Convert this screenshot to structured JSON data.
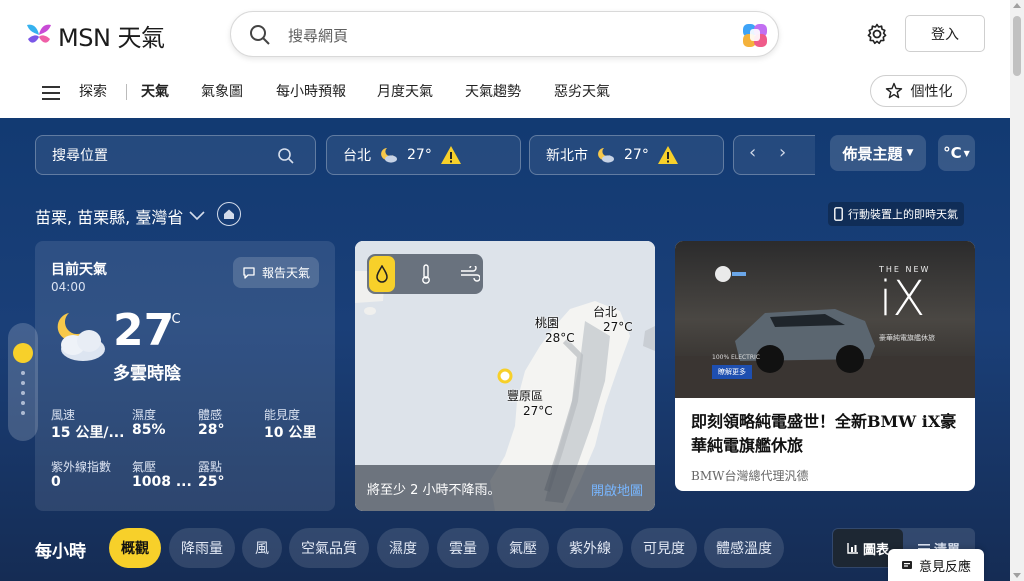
{
  "header": {
    "logo_text": "MSN 天氣",
    "search_placeholder": "搜尋網頁",
    "login_label": "登入"
  },
  "nav": {
    "explore": "探索",
    "items": [
      "天氣",
      "氣象圖",
      "每小時預報",
      "月度天氣",
      "天氣趨勢",
      "惡劣天氣"
    ],
    "active": "天氣",
    "personalize": "個性化"
  },
  "toolbar": {
    "location_search": "搜尋位置",
    "cities": [
      {
        "name": "台北",
        "temp": "27°"
      },
      {
        "name": "新北市",
        "temp": "27°"
      }
    ],
    "theme": "佈景主題",
    "unit": "°C"
  },
  "location": {
    "name": "苗栗, 苗栗縣, 臺灣省",
    "mobile_link": "行動裝置上的即時天氣"
  },
  "current": {
    "title": "目前天氣",
    "time": "04:00",
    "report_label": "報告天氣",
    "temp": "27",
    "unit": "°C",
    "condition": "多雲時陰",
    "stats": [
      {
        "label": "風速",
        "value": "15 公里/..."
      },
      {
        "label": "濕度",
        "value": "85%"
      },
      {
        "label": "體感",
        "value": "28°"
      },
      {
        "label": "能見度",
        "value": "10 公里"
      },
      {
        "label": "紫外線指數",
        "value": "0"
      },
      {
        "label": "氣壓",
        "value": "1008 ..."
      },
      {
        "label": "露點",
        "value": "25°"
      }
    ]
  },
  "map": {
    "labels": [
      {
        "name": "桃園",
        "temp": "28°C"
      },
      {
        "name": "台北",
        "temp": "27°C"
      },
      {
        "name": "豐原區",
        "temp": "27°C"
      }
    ],
    "footer_text": "將至少 2 小時不降雨。",
    "open_label": "開啟地圖"
  },
  "ad": {
    "brand_text": "THE NEW",
    "model_text": "iX",
    "sub_text": "豪華純電旗艦休旅",
    "badge_text": "100% ELECTRIC",
    "cta_text": "瞭解更多",
    "title": "即刻領略純電盛世！全新BMW iX豪華純電旗艦休旅",
    "source": "BMW台灣總代理汎德"
  },
  "hourly": {
    "label": "每小時",
    "tabs": [
      "概觀",
      "降雨量",
      "風",
      "空氣品質",
      "濕度",
      "雲量",
      "氣壓",
      "紫外線",
      "可見度",
      "體感溫度"
    ],
    "selected": "概觀",
    "view_chart": "圖表",
    "view_list": "清單"
  },
  "feedback": "意見反應",
  "colors": {
    "accent_yellow": "#f7d02a",
    "bg_blue": "#123a72"
  }
}
